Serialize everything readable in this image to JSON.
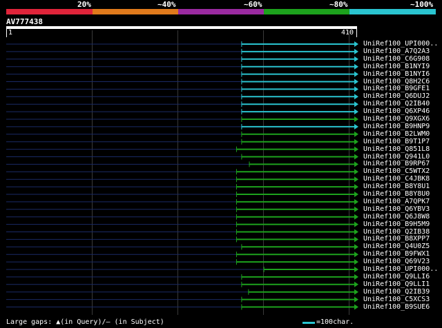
{
  "scale": {
    "labels": [
      "20%",
      "~40%",
      "~60%",
      "~80%",
      "~100%"
    ],
    "colors": [
      "#e0243a",
      "#e07a1c",
      "#9a2aa0",
      "#1da21d",
      "#2ac4d0"
    ]
  },
  "query": {
    "id": "AV777438",
    "start": "1",
    "end": "410",
    "length": 410
  },
  "hits": [
    {
      "name": "UniRef100_UPI000..",
      "start": 276,
      "end": 410,
      "color": "#2ac4d0"
    },
    {
      "name": "UniRef100_A7Q2A3",
      "start": 276,
      "end": 410,
      "color": "#2ac4d0"
    },
    {
      "name": "UniRef100_C6G908",
      "start": 276,
      "end": 410,
      "color": "#2ac4d0"
    },
    {
      "name": "UniRef100_B1NYI9",
      "start": 276,
      "end": 410,
      "color": "#2ac4d0"
    },
    {
      "name": "UniRef100_B1NYI6",
      "start": 276,
      "end": 410,
      "color": "#2ac4d0"
    },
    {
      "name": "UniRef100_Q8H2C6",
      "start": 276,
      "end": 410,
      "color": "#2ac4d0"
    },
    {
      "name": "UniRef100_B9GFE1",
      "start": 276,
      "end": 410,
      "color": "#2ac4d0"
    },
    {
      "name": "UniRef100_Q6DUJ2",
      "start": 276,
      "end": 410,
      "color": "#2ac4d0"
    },
    {
      "name": "UniRef100_Q2IB40",
      "start": 276,
      "end": 410,
      "color": "#2ac4d0"
    },
    {
      "name": "UniRef100_Q6XP46",
      "start": 276,
      "end": 410,
      "color": "#2ac4d0"
    },
    {
      "name": "UniRef100_Q9XGX6",
      "start": 276,
      "end": 410,
      "color": "#1da21d"
    },
    {
      "name": "UniRef100_B9HNP9",
      "start": 276,
      "end": 410,
      "color": "#2ac4d0"
    },
    {
      "name": "UniRef100_B2LWM0",
      "start": 276,
      "end": 410,
      "color": "#1da21d"
    },
    {
      "name": "UniRef100_B9T1P7",
      "start": 276,
      "end": 410,
      "color": "#1da21d"
    },
    {
      "name": "UniRef100_Q851L8",
      "start": 270,
      "end": 410,
      "color": "#1da21d"
    },
    {
      "name": "UniRef100_Q941L0",
      "start": 276,
      "end": 410,
      "color": "#1da21d"
    },
    {
      "name": "UniRef100_B9RP67",
      "start": 285,
      "end": 410,
      "color": "#1da21d"
    },
    {
      "name": "UniRef100_C5WTX2",
      "start": 270,
      "end": 410,
      "color": "#1da21d"
    },
    {
      "name": "UniRef100_C4JBK8",
      "start": 270,
      "end": 410,
      "color": "#1da21d"
    },
    {
      "name": "UniRef100_B8Y8U1",
      "start": 270,
      "end": 410,
      "color": "#1da21d"
    },
    {
      "name": "UniRef100_B8Y8U0",
      "start": 270,
      "end": 410,
      "color": "#1da21d"
    },
    {
      "name": "UniRef100_A7QPK7",
      "start": 270,
      "end": 410,
      "color": "#1da21d"
    },
    {
      "name": "UniRef100_Q6YBV3",
      "start": 270,
      "end": 410,
      "color": "#1da21d"
    },
    {
      "name": "UniRef100_Q6J8W8",
      "start": 270,
      "end": 410,
      "color": "#1da21d"
    },
    {
      "name": "UniRef100_B9H5M9",
      "start": 270,
      "end": 410,
      "color": "#1da21d"
    },
    {
      "name": "UniRef100_Q2IB38",
      "start": 270,
      "end": 410,
      "color": "#1da21d"
    },
    {
      "name": "UniRef100_B8XPP7",
      "start": 270,
      "end": 410,
      "color": "#1da21d"
    },
    {
      "name": "UniRef100_Q4U0Z5",
      "start": 276,
      "end": 410,
      "color": "#1da21d"
    },
    {
      "name": "UniRef100_B9FWX1",
      "start": 270,
      "end": 410,
      "color": "#1da21d"
    },
    {
      "name": "UniRef100_Q69V23",
      "start": 270,
      "end": 410,
      "color": "#1da21d"
    },
    {
      "name": "UniRef100_UPI000..",
      "start": 302,
      "end": 410,
      "color": "#1da21d"
    },
    {
      "name": "UniRef100_Q9LLI6",
      "start": 276,
      "end": 410,
      "color": "#1da21d"
    },
    {
      "name": "UniRef100_Q9LLI1",
      "start": 276,
      "end": 410,
      "color": "#1da21d"
    },
    {
      "name": "UniRef100_Q2IB39",
      "start": 284,
      "end": 410,
      "color": "#1da21d"
    },
    {
      "name": "UniRef100_C5XCS3",
      "start": 276,
      "end": 410,
      "color": "#1da21d"
    },
    {
      "name": "UniRef100_B9SUE6",
      "start": 276,
      "end": 410,
      "color": "#1da21d"
    }
  ],
  "footer": {
    "gaps_text": "Large gaps: ▲(in Query)/— (in Subject)",
    "legend_text": "=100char."
  }
}
